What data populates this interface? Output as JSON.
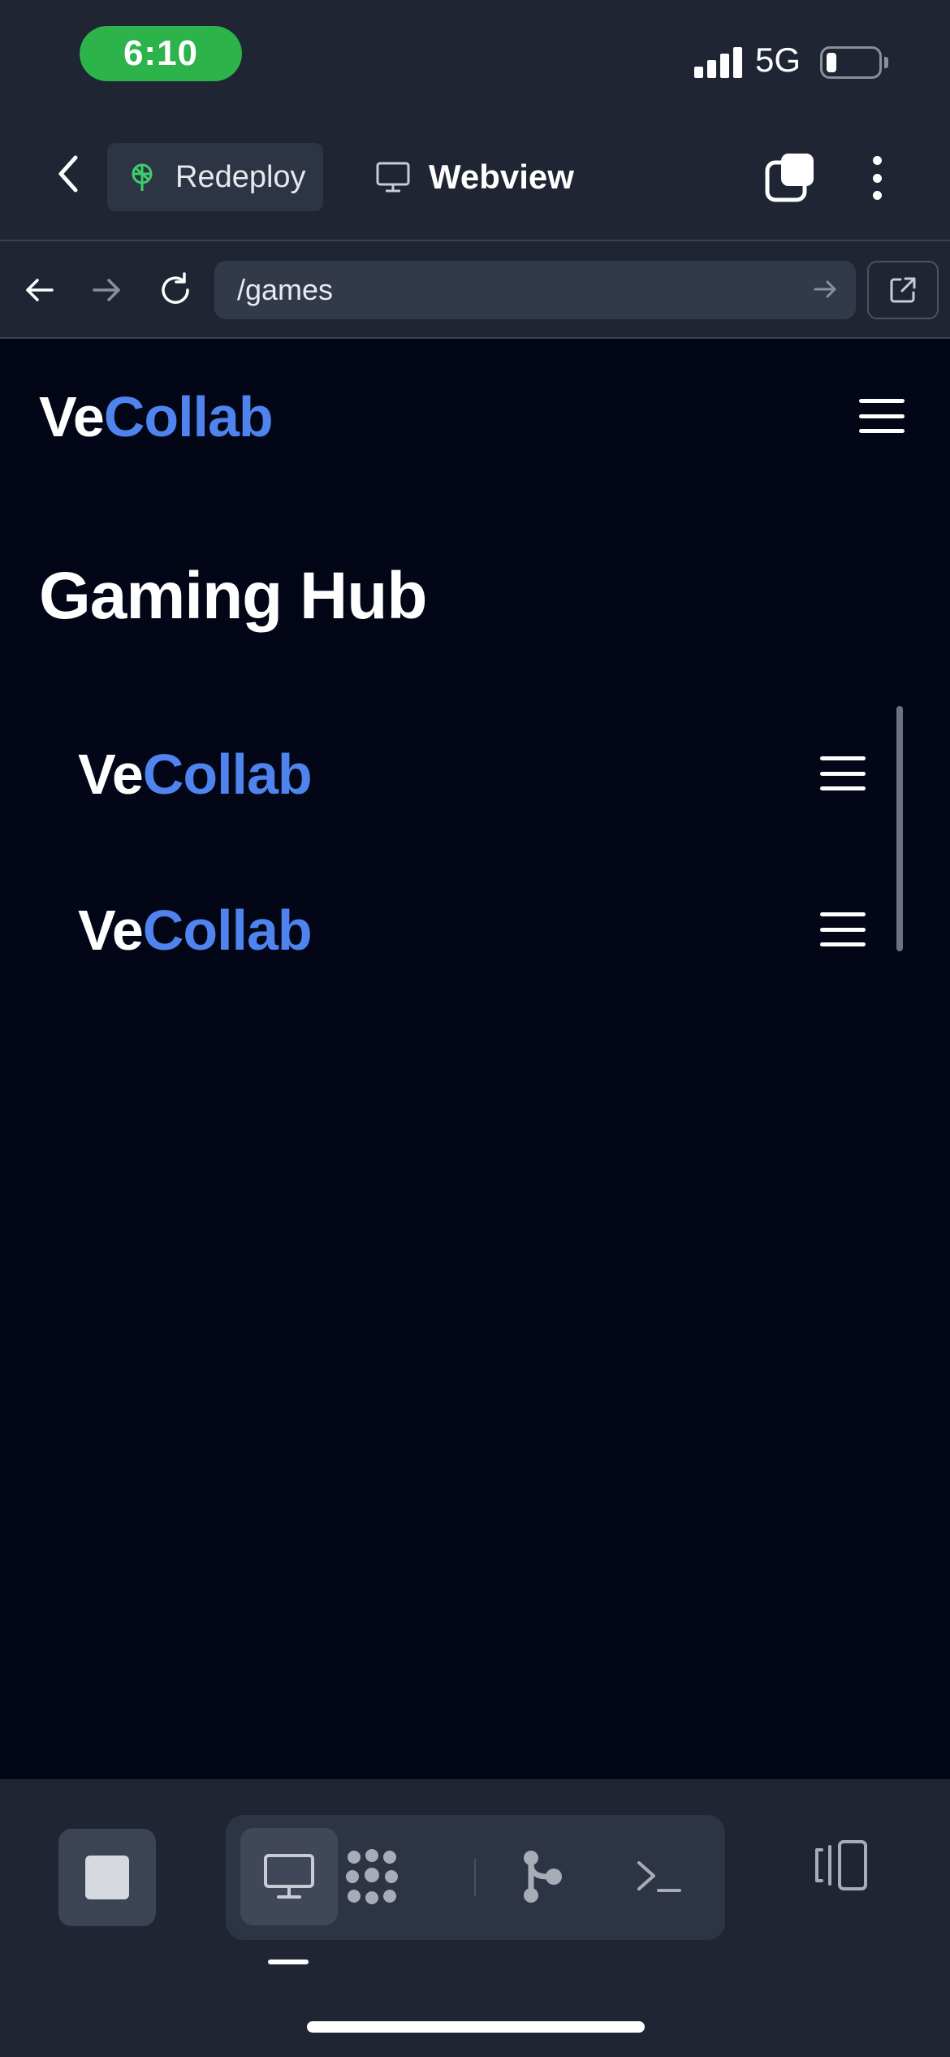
{
  "status_bar": {
    "time": "6:10",
    "network": "5G",
    "time_pill_color": "#2cb34a",
    "battery_level": 0.2
  },
  "header": {
    "back_icon": "chevron-left-icon",
    "redeploy_label": "Redeploy",
    "redeploy_icon": "deploy-icon",
    "tab_label": "Webview",
    "tab_icon": "monitor-icon",
    "windows_icon": "windows-icon",
    "more_icon": "more-vertical-icon"
  },
  "url_bar": {
    "value": "/games",
    "back_icon": "arrow-left-icon",
    "forward_icon": "arrow-right-icon",
    "reload_icon": "reload-icon",
    "go_icon": "arrow-right-icon",
    "external_icon": "external-link-icon"
  },
  "webview": {
    "background": "#020617",
    "logo": {
      "part1": "Ve",
      "part2": "Collab",
      "accent": "#4f84ee"
    },
    "title": "Gaming Hub",
    "inner_items": [
      {
        "part1": "Ve",
        "part2": "Collab"
      },
      {
        "part1": "Ve",
        "part2": "Collab"
      }
    ]
  },
  "toolbar": {
    "stop_icon": "stop-icon",
    "tools": [
      {
        "icon": "monitor-icon",
        "active": true
      },
      {
        "icon": "nodes-icon",
        "active": false
      },
      {
        "icon": "git-icon",
        "active": false
      },
      {
        "icon": "terminal-icon",
        "active": false
      }
    ],
    "panel_icon": "panel-icon"
  }
}
